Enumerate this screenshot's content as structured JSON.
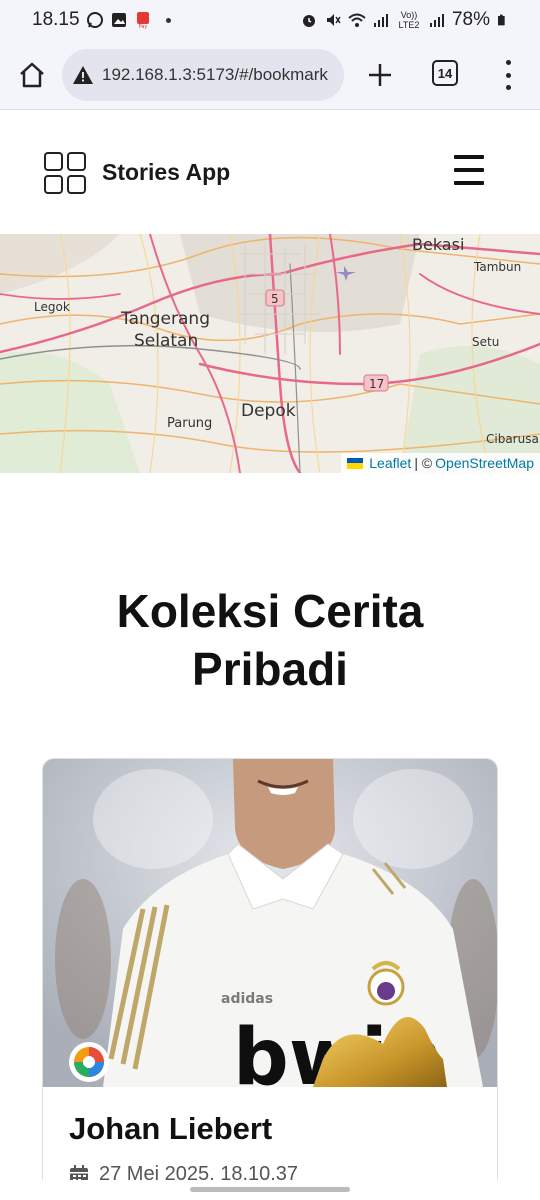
{
  "status_bar": {
    "time": "18.15",
    "battery": "78%",
    "network_label": "Vo)) LTE2"
  },
  "browser": {
    "url": "192.168.1.3:5173/#/bookmark",
    "tab_count": "14"
  },
  "app": {
    "brand": "Stories App"
  },
  "map": {
    "labels": [
      "Bekasi",
      "Tambun",
      "Legok",
      "Tangerang",
      "Selatan",
      "5",
      "Setu",
      "17",
      "Parung",
      "Depok",
      "Cibarusa"
    ],
    "attribution_leaflet": "Leaflet",
    "attribution_sep": "| ©",
    "attribution_osm": "OpenStreetMap"
  },
  "page": {
    "title_line1": "Koleksi Cerita",
    "title_line2": "Pribadi"
  },
  "story": {
    "name": "Johan Liebert",
    "date": "27 Mei 2025, 18.10.37",
    "image_brand": "adidas",
    "image_sponsor": "bwin"
  },
  "colors": {
    "accent_link": "#0078a8",
    "flag_top": "#0057b7",
    "flag_bottom": "#ffd700"
  }
}
